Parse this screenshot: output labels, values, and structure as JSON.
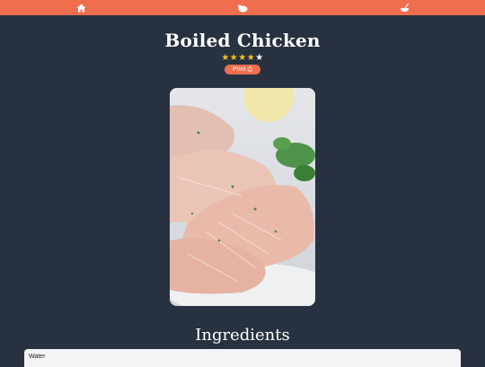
{
  "nav": {
    "items": [
      {
        "icon": "home-icon"
      },
      {
        "icon": "chicken-icon"
      },
      {
        "icon": "mixing-bowl-icon"
      }
    ],
    "background": "#ef6e4e"
  },
  "recipe": {
    "title": "Boiled Chicken",
    "rating": 4,
    "rating_max": 5,
    "print_label": "Print ⎙",
    "photo_alt": "Boiled Chicken"
  },
  "ingredients": {
    "heading": "Ingredients",
    "items": [
      "Water"
    ]
  },
  "colors": {
    "page_background": "#283140",
    "accent": "#ef6e4e",
    "star_on": "#f0c419",
    "star_off": "#ffffff"
  }
}
